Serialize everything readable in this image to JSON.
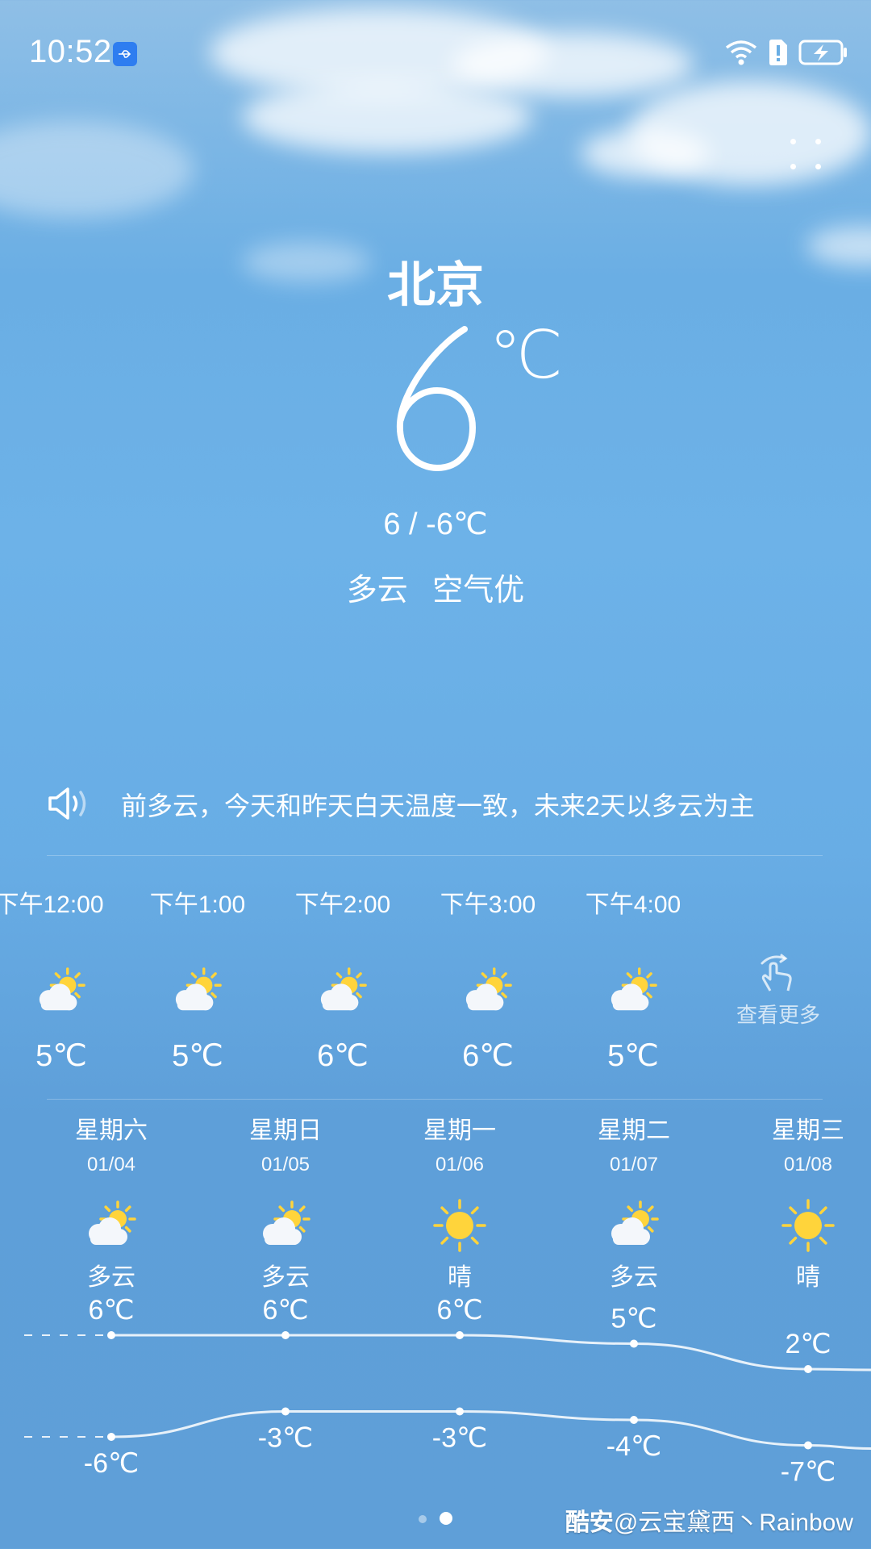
{
  "status": {
    "time": "10:52"
  },
  "weather": {
    "city": "北京",
    "temp": "6",
    "unit": "℃",
    "hilo": "6 / -6℃",
    "condition": "多云",
    "air": "空气优"
  },
  "notice": {
    "text": "目前多云，今天和昨天白天温度一致，未来2天以多云为主"
  },
  "hourly": [
    {
      "time": "下午12:00",
      "temp": "5℃",
      "icon": "partly-cloudy-icon"
    },
    {
      "time": "下午1:00",
      "temp": "5℃",
      "icon": "partly-cloudy-icon"
    },
    {
      "time": "下午2:00",
      "temp": "6℃",
      "icon": "partly-cloudy-icon"
    },
    {
      "time": "下午3:00",
      "temp": "6℃",
      "icon": "partly-cloudy-icon"
    },
    {
      "time": "下午4:00",
      "temp": "5℃",
      "icon": "partly-cloudy-icon"
    }
  ],
  "see_more": "查看更多",
  "daily": [
    {
      "name": "星期六",
      "date": "01/04",
      "cond": "多云",
      "icon": "partly-cloudy-icon",
      "high": "6℃",
      "low": "-6℃",
      "high_val": 6,
      "low_val": -6
    },
    {
      "name": "星期日",
      "date": "01/05",
      "cond": "多云",
      "icon": "partly-cloudy-icon",
      "high": "6℃",
      "low": "-3℃",
      "high_val": 6,
      "low_val": -3
    },
    {
      "name": "星期一",
      "date": "01/06",
      "cond": "晴",
      "icon": "sun-icon",
      "high": "6℃",
      "low": "-3℃",
      "high_val": 6,
      "low_val": -3
    },
    {
      "name": "星期二",
      "date": "01/07",
      "cond": "多云",
      "icon": "partly-cloudy-icon",
      "high": "5℃",
      "low": "-4℃",
      "high_val": 5,
      "low_val": -4
    },
    {
      "name": "星期三",
      "date": "01/08",
      "cond": "晴",
      "icon": "sun-icon",
      "high": "2℃",
      "low": "-7℃",
      "high_val": 2,
      "low_val": -7
    }
  ],
  "watermark": {
    "brand": "酷安",
    "user": "@云宝黛西丶Rainbow"
  },
  "colors": {
    "sun": "#ffd43b",
    "accent_usb": "#2e7df0"
  }
}
